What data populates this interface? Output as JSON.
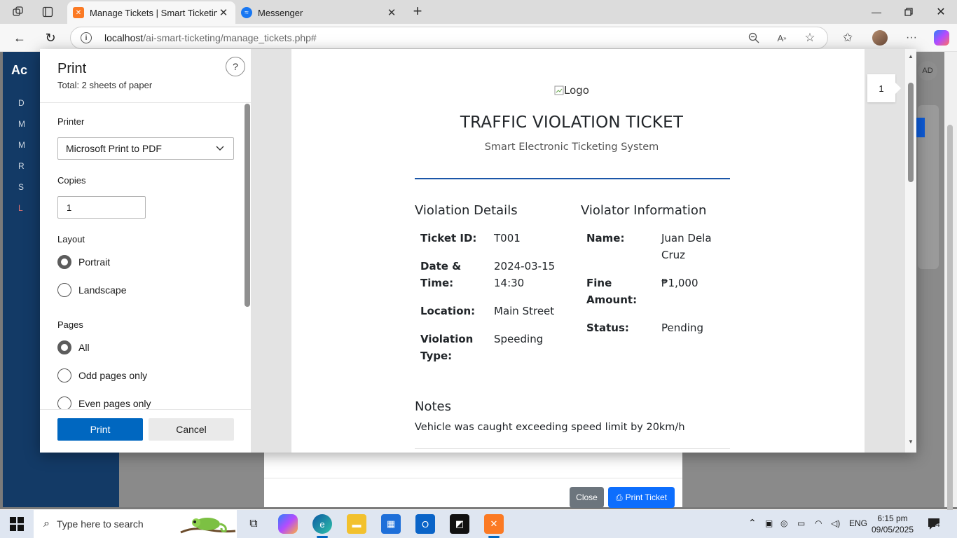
{
  "browser": {
    "tabs": [
      {
        "title": "Manage Tickets | Smart Ticketing",
        "active": true
      },
      {
        "title": "Messenger",
        "active": false
      }
    ],
    "url_host": "localhost",
    "url_path": "/ai-smart-ticketing/manage_tickets.php#"
  },
  "app": {
    "brand": "Ac",
    "sidebar_items": [
      "D",
      "M",
      "M",
      "R",
      "S",
      "L"
    ],
    "user_badge": "AD",
    "footer_buttons": {
      "close": "Close",
      "print_ticket": "Print Ticket"
    }
  },
  "print_dialog": {
    "title": "Print",
    "total": "Total: 2 sheets of paper",
    "help": "?",
    "printer_label": "Printer",
    "printer_value": "Microsoft Print to PDF",
    "copies_label": "Copies",
    "copies_value": "1",
    "layout_label": "Layout",
    "layout_options": [
      "Portrait",
      "Landscape"
    ],
    "layout_selected": "Portrait",
    "pages_label": "Pages",
    "pages_options": [
      "All",
      "Odd pages only",
      "Even pages only"
    ],
    "pages_selected": "All",
    "print_button": "Print",
    "cancel_button": "Cancel",
    "page_number": "1"
  },
  "ticket": {
    "logo_alt": "Logo",
    "title": "TRAFFIC VIOLATION TICKET",
    "subtitle": "Smart Electronic Ticketing System",
    "violation_heading": "Violation Details",
    "violator_heading": "Violator Information",
    "violation_fields": [
      {
        "label": "Ticket ID:",
        "value": "T001"
      },
      {
        "label": "Date & Time:",
        "value": "2024-03-15 14:30"
      },
      {
        "label": "Location:",
        "value": "Main Street"
      },
      {
        "label": "Violation Type:",
        "value": "Speeding"
      }
    ],
    "violator_fields": [
      {
        "label": "Name:",
        "value": "Juan Dela Cruz"
      },
      {
        "label": "Fine Amount:",
        "value": "₱1,000"
      },
      {
        "label": "Status:",
        "value": "Pending"
      }
    ],
    "notes_heading": "Notes",
    "notes_text": "Vehicle was caught exceeding speed limit by 20km/h"
  },
  "taskbar": {
    "search_placeholder": "Type here to search",
    "language": "ENG",
    "time": "6:15 pm",
    "date": "09/05/2025",
    "notification_count": "4"
  },
  "colors": {
    "accent": "#0067c0",
    "ticket_rule": "#1b56a8",
    "sidebar": "#133a66",
    "bootstrap_primary": "#0d6efd",
    "bootstrap_secondary": "#6c757d"
  }
}
